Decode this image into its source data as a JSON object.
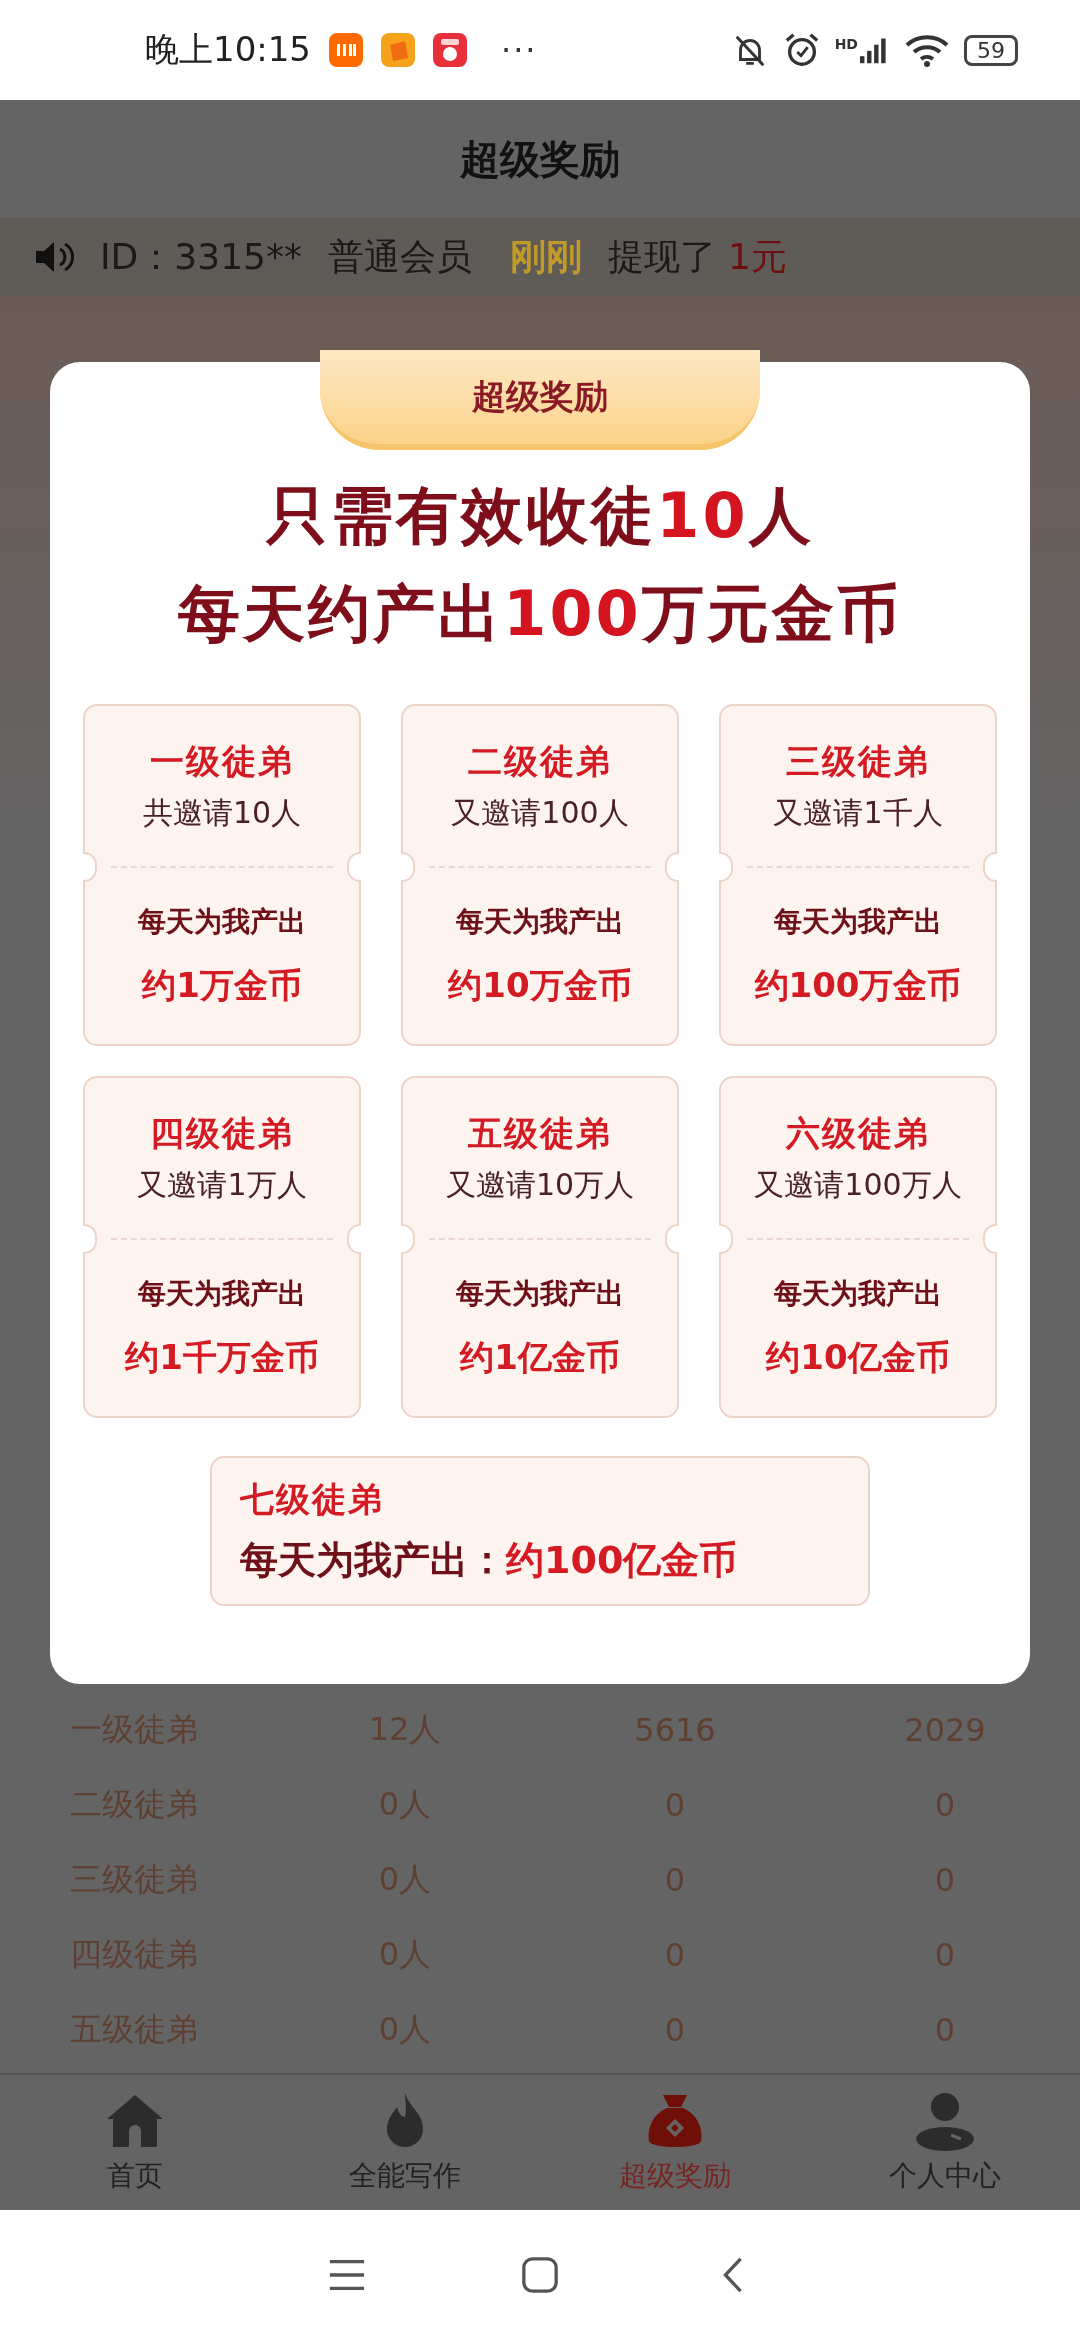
{
  "status_bar": {
    "time": "晚上10:15",
    "more": "···",
    "hd": "HD",
    "battery": "59"
  },
  "header": {
    "title": "超级奖励"
  },
  "ticker": {
    "id": "ID：3315**",
    "member": "普通会员",
    "when": "刚刚",
    "action": "提现了",
    "amount": "1元"
  },
  "modal": {
    "ribbon": "超级奖励",
    "headline": [
      "只需有效收徒**10**人",
      "每天约产出**100**万元金币"
    ],
    "levels": [
      {
        "title": "一级徒弟",
        "invite": "共邀请10人",
        "label": "每天为我产出",
        "amount": "约1万金币"
      },
      {
        "title": "二级徒弟",
        "invite": "又邀请100人",
        "label": "每天为我产出",
        "amount": "约10万金币"
      },
      {
        "title": "三级徒弟",
        "invite": "又邀请1千人",
        "label": "每天为我产出",
        "amount": "约100万金币"
      },
      {
        "title": "四级徒弟",
        "invite": "又邀请1万人",
        "label": "每天为我产出",
        "amount": "约1千万金币"
      },
      {
        "title": "五级徒弟",
        "invite": "又邀请10万人",
        "label": "每天为我产出",
        "amount": "约1亿金币"
      },
      {
        "title": "六级徒弟",
        "invite": "又邀请100万人",
        "label": "每天为我产出",
        "amount": "约10亿金币"
      }
    ],
    "top_level": {
      "title": "七级徒弟",
      "label": "每天为我产出：",
      "amount": "约100亿金币"
    }
  },
  "table": {
    "rows": [
      [
        "一级徒弟",
        "12人",
        "5616",
        "2029"
      ],
      [
        "二级徒弟",
        "0人",
        "0",
        "0"
      ],
      [
        "三级徒弟",
        "0人",
        "0",
        "0"
      ],
      [
        "四级徒弟",
        "0人",
        "0",
        "0"
      ],
      [
        "五级徒弟",
        "0人",
        "0",
        "0"
      ]
    ]
  },
  "tabs": [
    {
      "label": "首页",
      "selected": false
    },
    {
      "label": "全能写作",
      "selected": false
    },
    {
      "label": "超级奖励",
      "selected": true
    },
    {
      "label": "个人中心",
      "selected": false
    }
  ]
}
